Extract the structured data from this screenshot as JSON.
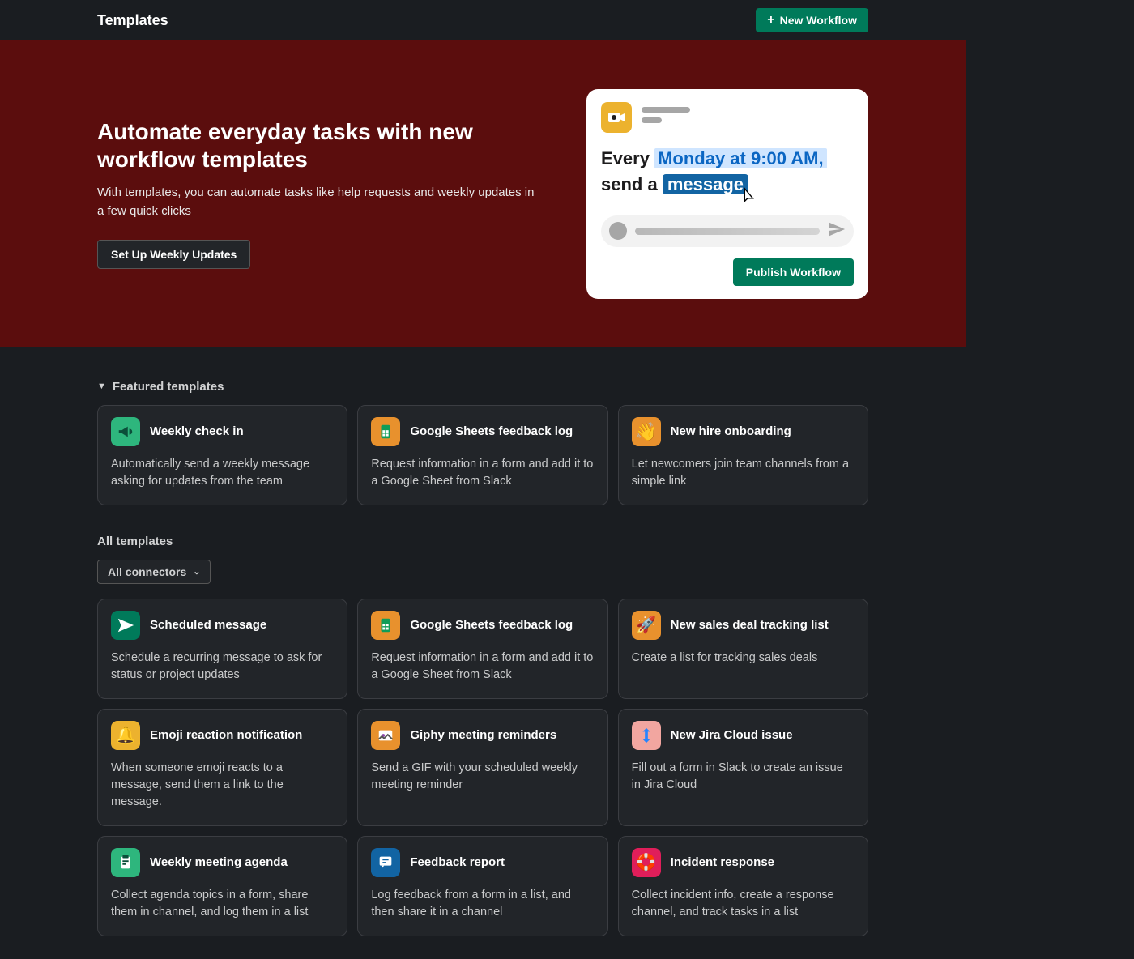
{
  "header": {
    "title": "Templates",
    "new_workflow": "New Workflow"
  },
  "hero": {
    "heading": "Automate everyday tasks with new workflow templates",
    "subheading": "With templates, you can automate tasks like help requests and weekly updates in a few quick clicks",
    "cta": "Set Up Weekly Updates",
    "card": {
      "every": "Every ",
      "time_highlight": "Monday at 9:00 AM,",
      "send_a": "send a ",
      "message_highlight": "message",
      "publish": "Publish Workflow"
    }
  },
  "featured": {
    "heading": "Featured templates",
    "items": [
      {
        "title": "Weekly check in",
        "desc": "Automatically send a weekly message asking for updates from the team",
        "bg": "#2eb67d",
        "icon": "megaphone"
      },
      {
        "title": "Google Sheets feedback log",
        "desc": "Request information in a form and add it to a Google Sheet from Slack",
        "bg": "#e8912d",
        "icon": "sheets"
      },
      {
        "title": "New hire onboarding",
        "desc": "Let newcomers join team channels from a simple link",
        "bg": "#e8912d",
        "icon": "wave"
      }
    ]
  },
  "all": {
    "heading": "All templates",
    "filter": "All connectors",
    "items": [
      {
        "title": "Scheduled message",
        "desc": "Schedule a recurring message to ask for status or project updates",
        "bg": "#007a5a",
        "icon": "paperplane"
      },
      {
        "title": "Google Sheets feedback log",
        "desc": "Request information in a form and add it to a Google Sheet from Slack",
        "bg": "#e8912d",
        "icon": "sheets"
      },
      {
        "title": "New sales deal tracking list",
        "desc": "Create a list for tracking sales deals",
        "bg": "#e8912d",
        "icon": "rocket"
      },
      {
        "title": "Emoji reaction notification",
        "desc": "When someone emoji reacts to a message, send them a link to the message.",
        "bg": "#ecb22e",
        "icon": "bell"
      },
      {
        "title": "Giphy meeting reminders",
        "desc": "Send a GIF with your scheduled weekly meeting reminder",
        "bg": "#e8912d",
        "icon": "gif"
      },
      {
        "title": "New Jira Cloud issue",
        "desc": "Fill out a form in Slack to create an issue in Jira Cloud",
        "bg": "#f2a6a0",
        "icon": "jira"
      },
      {
        "title": "Weekly meeting agenda",
        "desc": "Collect agenda topics in a form, share them in channel, and log them in a list",
        "bg": "#2eb67d",
        "icon": "clipboard"
      },
      {
        "title": "Feedback report",
        "desc": "Log feedback from a form in a list, and then share it in a channel",
        "bg": "#1264a3",
        "icon": "feedback"
      },
      {
        "title": "Incident response",
        "desc": "Collect incident info, create a response channel, and track tasks in a list",
        "bg": "#e01e5a",
        "icon": "lifering"
      }
    ]
  }
}
